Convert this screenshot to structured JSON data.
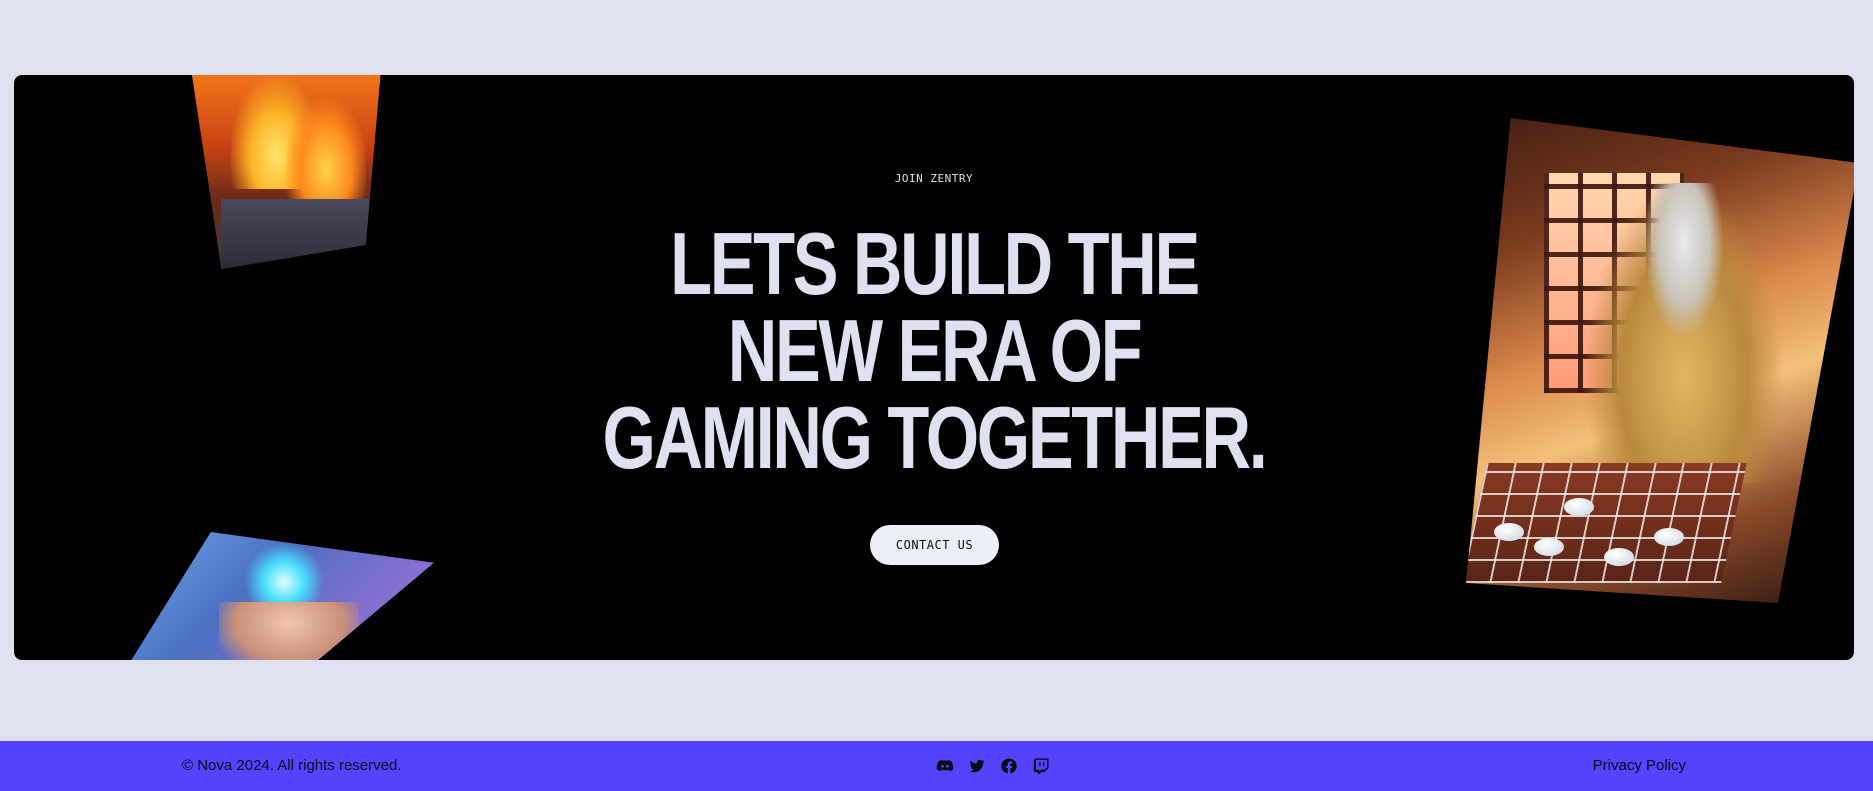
{
  "hero": {
    "eyebrow": "JOIN ZENTRY",
    "headline": [
      "LETS BUILD THE",
      "NEW ERA OF",
      "GAMING TOGETHER."
    ],
    "cta_label": "CONTACT US"
  },
  "footer": {
    "copyright": "© Nova 2024. All rights reserved.",
    "privacy_label": "Privacy Policy",
    "socials": [
      {
        "icon": "discord-icon"
      },
      {
        "icon": "twitter-icon"
      },
      {
        "icon": "facebook-icon"
      },
      {
        "icon": "twitch-icon"
      }
    ]
  },
  "colors": {
    "page_background": "#dfe0f0",
    "hero_background": "#000000",
    "headline": "#dfe0f0",
    "footer_background": "#5542ff"
  }
}
